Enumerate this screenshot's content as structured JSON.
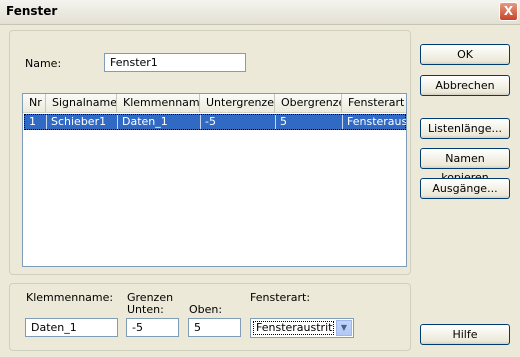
{
  "window": {
    "title": "Fenster",
    "close_symbol": "X"
  },
  "name_field": {
    "label": "Name:",
    "value": "Fenster1"
  },
  "table": {
    "columns": [
      "Nr",
      "Signalname",
      "Klemmenname",
      "Untergrenze",
      "Obergrenze",
      "Fensterart"
    ],
    "rows": [
      {
        "nr": "1",
        "signalname": "Schieber1",
        "klemmenname": "Daten_1",
        "untergrenze": "-5",
        "obergrenze": "5",
        "fensterart": "Fensteraust"
      }
    ]
  },
  "editor": {
    "klemmenname_label": "Klemmenname:",
    "grenzen_label": "Grenzen",
    "unten_label": "Unten:",
    "oben_label": "Oben:",
    "fensterart_label": "Fensterart:",
    "klemmenname_value": "Daten_1",
    "unten_value": "-5",
    "oben_value": "5",
    "fensterart_value": "Fensteraustritt"
  },
  "buttons": {
    "ok": "OK",
    "abbrechen": "Abbrechen",
    "listenlaenge": "Listenlänge...",
    "namen_kopieren": "Namen kopieren",
    "ausgaenge": "Ausgänge...",
    "hilfe": "Hilfe"
  },
  "icons": {
    "close": "close-icon",
    "dropdown": "chevron-down-icon"
  }
}
